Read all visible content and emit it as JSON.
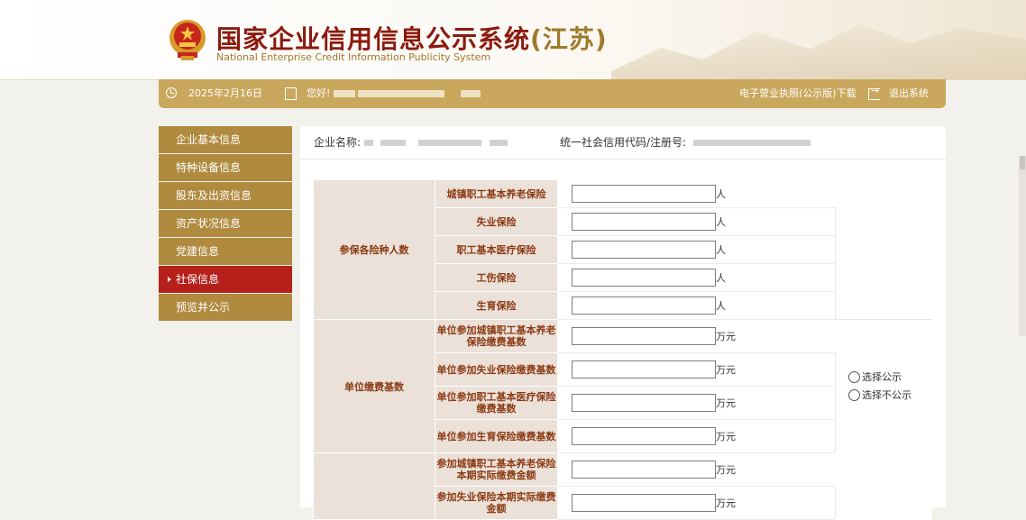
{
  "header": {
    "title": "国家企业信用信息公示系统",
    "region": "(江苏)",
    "subtitle": "National Enterprise Credit Information Publicity System"
  },
  "topbar": {
    "date": "2025年2月16日",
    "greeting": "您好!",
    "license_download": "电子营业执照(公示版)下载",
    "logout": "退出系统"
  },
  "sidebar": {
    "items": [
      {
        "label": "企业基本信息"
      },
      {
        "label": "特种设备信息"
      },
      {
        "label": "股东及出资信息"
      },
      {
        "label": "资产状况信息"
      },
      {
        "label": "党建信息"
      },
      {
        "label": "社保信息",
        "active": true
      },
      {
        "label": "预览并公示"
      }
    ]
  },
  "company": {
    "name_label": "企业名称:",
    "code_label": "统一社会信用代码/注册号:"
  },
  "form": {
    "group_insured": "参保各险种人数",
    "group_base": "单位缴费基数",
    "unit_person": "人",
    "unit_wan": "万元",
    "rows_insured": [
      "城镇职工基本养老保险",
      "失业保险",
      "职工基本医疗保险",
      "工伤保险",
      "生育保险"
    ],
    "rows_base": [
      "单位参加城镇职工基本养老保险缴费基数",
      "单位参加失业保险缴费基数",
      "单位参加职工基本医疗保险缴费基数",
      "单位参加生育保险缴费基数"
    ],
    "rows_actual": [
      "参加城镇职工基本养老保险本期实际缴费金额",
      "参加失业保险本期实际缴费金额"
    ],
    "radio_public": "选择公示",
    "radio_private": "选择不公示"
  },
  "colors": {
    "brand_red": "#b5201b",
    "gold": "#c9a75c",
    "sidebar_gold": "#b08a3e",
    "label_bg": "#ebe1d9"
  }
}
